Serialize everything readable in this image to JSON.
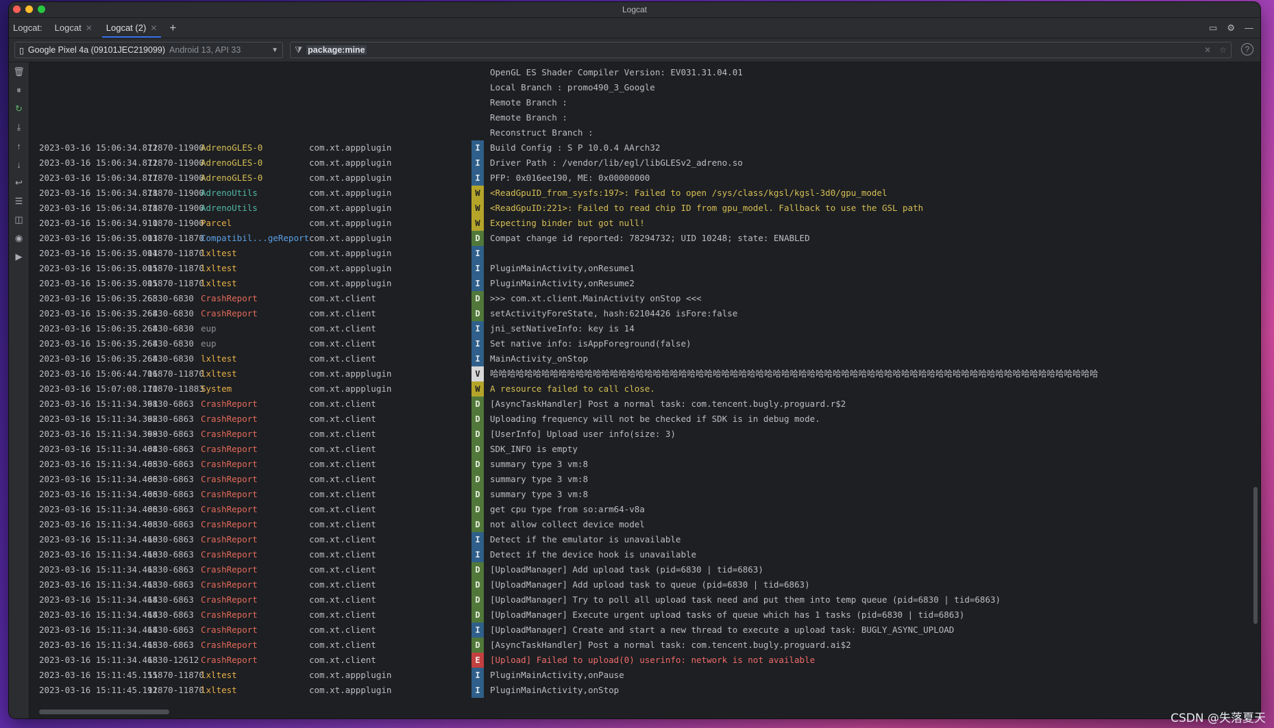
{
  "window": {
    "title": "Logcat"
  },
  "tabs": {
    "prefix": "Logcat:",
    "items": [
      {
        "label": "Logcat",
        "active": false
      },
      {
        "label": "Logcat (2)",
        "active": true
      }
    ]
  },
  "device": {
    "name": "Google Pixel 4a (09101JEC219099)",
    "detail": "Android 13, API 33"
  },
  "filter": {
    "value": "package:mine"
  },
  "header_rows": [
    "OpenGL ES Shader Compiler Version: EV031.31.04.01",
    "Local Branch                     : promo490_3_Google",
    "Remote Branch                    :",
    "Remote Branch                    :",
    "Reconstruct Branch               :"
  ],
  "log_rows": [
    {
      "time": "2023-03-16 15:06:34.872",
      "pid": "11870-11900",
      "tag": "AdrenoGLES-0",
      "tagc": "yellow",
      "pkg": "com.xt.appplugin",
      "lvl": "I",
      "msg": "Build Config                     : S P 10.0.4 AArch32"
    },
    {
      "time": "2023-03-16 15:06:34.872",
      "pid": "11870-11900",
      "tag": "AdrenoGLES-0",
      "tagc": "yellow",
      "pkg": "com.xt.appplugin",
      "lvl": "I",
      "msg": "Driver Path                      : /vendor/lib/egl/libGLESv2_adreno.so"
    },
    {
      "time": "2023-03-16 15:06:34.877",
      "pid": "11870-11900",
      "tag": "AdrenoGLES-0",
      "tagc": "yellow",
      "pkg": "com.xt.appplugin",
      "lvl": "I",
      "msg": "PFP: 0x016ee190, ME: 0x00000000"
    },
    {
      "time": "2023-03-16 15:06:34.878",
      "pid": "11870-11900",
      "tag": "AdrenoUtils",
      "tagc": "teal",
      "pkg": "com.xt.appplugin",
      "lvl": "W",
      "msg": "<ReadGpuID_from_sysfs:197>: Failed to open /sys/class/kgsl/kgsl-3d0/gpu_model"
    },
    {
      "time": "2023-03-16 15:06:34.878",
      "pid": "11870-11900",
      "tag": "AdrenoUtils",
      "tagc": "teal",
      "pkg": "com.xt.appplugin",
      "lvl": "W",
      "msg": "<ReadGpuID:221>: Failed to read chip ID from gpu_model. Fallback to use the GSL path"
    },
    {
      "time": "2023-03-16 15:06:34.910",
      "pid": "11870-11900",
      "tag": "Parcel",
      "tagc": "orange",
      "pkg": "com.xt.appplugin",
      "lvl": "W",
      "msg": "Expecting binder but got null!"
    },
    {
      "time": "2023-03-16 15:06:35.003",
      "pid": "11870-11870",
      "tag": "Compatibil...geReporter",
      "tagc": "blue",
      "pkg": "com.xt.appplugin",
      "lvl": "D",
      "msg": "Compat change id reported: 78294732; UID 10248; state: ENABLED"
    },
    {
      "time": "2023-03-16 15:06:35.004",
      "pid": "11870-11870",
      "tag": "lxltest",
      "tagc": "orange",
      "pkg": "com.xt.appplugin",
      "lvl": "I",
      "msg": ""
    },
    {
      "time": "2023-03-16 15:06:35.005",
      "pid": "11870-11870",
      "tag": "lxltest",
      "tagc": "orange",
      "pkg": "com.xt.appplugin",
      "lvl": "I",
      "msg": "PluginMainActivity,onResume1"
    },
    {
      "time": "2023-03-16 15:06:35.005",
      "pid": "11870-11870",
      "tag": "lxltest",
      "tagc": "orange",
      "pkg": "com.xt.appplugin",
      "lvl": "I",
      "msg": "PluginMainActivity,onResume2"
    },
    {
      "time": "2023-03-16 15:06:35.263",
      "pid": " 6830-6830",
      "tag": "CrashReport",
      "tagc": "red",
      "pkg": "com.xt.client",
      "lvl": "D",
      "msg": ">>> com.xt.client.MainActivity onStop <<<"
    },
    {
      "time": "2023-03-16 15:06:35.264",
      "pid": " 6830-6830",
      "tag": "CrashReport",
      "tagc": "red",
      "pkg": "com.xt.client",
      "lvl": "D",
      "msg": "setActivityForeState, hash:62104426 isFore:false"
    },
    {
      "time": "2023-03-16 15:06:35.264",
      "pid": " 6830-6830",
      "tag": "eup",
      "tagc": "gray",
      "pkg": "com.xt.client",
      "lvl": "I",
      "msg": "jni_setNativeInfo: key is 14"
    },
    {
      "time": "2023-03-16 15:06:35.264",
      "pid": " 6830-6830",
      "tag": "eup",
      "tagc": "gray",
      "pkg": "com.xt.client",
      "lvl": "I",
      "msg": "Set native info: isAppForeground(false)"
    },
    {
      "time": "2023-03-16 15:06:35.264",
      "pid": " 6830-6830",
      "tag": "lxltest",
      "tagc": "orange",
      "pkg": "com.xt.client",
      "lvl": "I",
      "msg": "MainActivity_onStop"
    },
    {
      "time": "2023-03-16 15:06:44.706",
      "pid": "11870-11870",
      "tag": "lxltest",
      "tagc": "orange",
      "pkg": "com.xt.appplugin",
      "lvl": "V",
      "msg": "哈哈哈哈哈哈哈哈哈哈哈哈哈哈哈哈哈哈哈哈哈哈哈哈哈哈哈哈哈哈哈哈哈哈哈哈哈哈哈哈哈哈哈哈哈哈哈哈哈哈哈哈哈哈哈哈哈哈哈哈哈哈哈哈哈哈哈哈哈哈哈"
    },
    {
      "time": "2023-03-16 15:07:08.170",
      "pid": "11870-11883",
      "tag": "System",
      "tagc": "orange",
      "pkg": "com.xt.appplugin",
      "lvl": "W",
      "msg": "A resource failed to call close."
    },
    {
      "time": "2023-03-16 15:11:34.391",
      "pid": " 6830-6863",
      "tag": "CrashReport",
      "tagc": "red",
      "pkg": "com.xt.client",
      "lvl": "D",
      "msg": "[AsyncTaskHandler] Post a normal task: com.tencent.bugly.proguard.r$2"
    },
    {
      "time": "2023-03-16 15:11:34.392",
      "pid": " 6830-6863",
      "tag": "CrashReport",
      "tagc": "red",
      "pkg": "com.xt.client",
      "lvl": "D",
      "msg": "Uploading frequency will not be checked if SDK is in debug mode."
    },
    {
      "time": "2023-03-16 15:11:34.399",
      "pid": " 6830-6863",
      "tag": "CrashReport",
      "tagc": "red",
      "pkg": "com.xt.client",
      "lvl": "D",
      "msg": "[UserInfo] Upload user info(size: 3)"
    },
    {
      "time": "2023-03-16 15:11:34.404",
      "pid": " 6830-6863",
      "tag": "CrashReport",
      "tagc": "red",
      "pkg": "com.xt.client",
      "lvl": "D",
      "msg": "SDK_INFO is empty"
    },
    {
      "time": "2023-03-16 15:11:34.405",
      "pid": " 6830-6863",
      "tag": "CrashReport",
      "tagc": "red",
      "pkg": "com.xt.client",
      "lvl": "D",
      "msg": "summary type 3 vm:8"
    },
    {
      "time": "2023-03-16 15:11:34.406",
      "pid": " 6830-6863",
      "tag": "CrashReport",
      "tagc": "red",
      "pkg": "com.xt.client",
      "lvl": "D",
      "msg": "summary type 3 vm:8"
    },
    {
      "time": "2023-03-16 15:11:34.406",
      "pid": " 6830-6863",
      "tag": "CrashReport",
      "tagc": "red",
      "pkg": "com.xt.client",
      "lvl": "D",
      "msg": "summary type 3 vm:8"
    },
    {
      "time": "2023-03-16 15:11:34.406",
      "pid": " 6830-6863",
      "tag": "CrashReport",
      "tagc": "red",
      "pkg": "com.xt.client",
      "lvl": "D",
      "msg": "get cpu type from so:arm64-v8a"
    },
    {
      "time": "2023-03-16 15:11:34.408",
      "pid": " 6830-6863",
      "tag": "CrashReport",
      "tagc": "red",
      "pkg": "com.xt.client",
      "lvl": "D",
      "msg": "not allow collect device model"
    },
    {
      "time": "2023-03-16 15:11:34.410",
      "pid": " 6830-6863",
      "tag": "CrashReport",
      "tagc": "red",
      "pkg": "com.xt.client",
      "lvl": "I",
      "msg": "Detect if the emulator is unavailable"
    },
    {
      "time": "2023-03-16 15:11:34.410",
      "pid": " 6830-6863",
      "tag": "CrashReport",
      "tagc": "red",
      "pkg": "com.xt.client",
      "lvl": "I",
      "msg": "Detect if the device hook is unavailable"
    },
    {
      "time": "2023-03-16 15:11:34.413",
      "pid": " 6830-6863",
      "tag": "CrashReport",
      "tagc": "red",
      "pkg": "com.xt.client",
      "lvl": "D",
      "msg": "[UploadManager] Add upload task (pid=6830 | tid=6863)"
    },
    {
      "time": "2023-03-16 15:11:34.413",
      "pid": " 6830-6863",
      "tag": "CrashReport",
      "tagc": "red",
      "pkg": "com.xt.client",
      "lvl": "D",
      "msg": "[UploadManager] Add upload task to queue (pid=6830 | tid=6863)"
    },
    {
      "time": "2023-03-16 15:11:34.414",
      "pid": " 6830-6863",
      "tag": "CrashReport",
      "tagc": "red",
      "pkg": "com.xt.client",
      "lvl": "D",
      "msg": "[UploadManager] Try to poll all upload task need and put them into temp queue (pid=6830 | tid=6863)"
    },
    {
      "time": "2023-03-16 15:11:34.414",
      "pid": " 6830-6863",
      "tag": "CrashReport",
      "tagc": "red",
      "pkg": "com.xt.client",
      "lvl": "D",
      "msg": "[UploadManager] Execute urgent upload tasks of queue which has 1 tasks (pid=6830 | tid=6863)"
    },
    {
      "time": "2023-03-16 15:11:34.414",
      "pid": " 6830-6863",
      "tag": "CrashReport",
      "tagc": "red",
      "pkg": "com.xt.client",
      "lvl": "I",
      "msg": "[UploadManager] Create and start a new thread to execute a upload task: BUGLY_ASYNC_UPLOAD"
    },
    {
      "time": "2023-03-16 15:11:34.415",
      "pid": " 6830-6863",
      "tag": "CrashReport",
      "tagc": "red",
      "pkg": "com.xt.client",
      "lvl": "D",
      "msg": "[AsyncTaskHandler] Post a normal task: com.tencent.bugly.proguard.ai$2"
    },
    {
      "time": "2023-03-16 15:11:34.418",
      "pid": " 6830-12612",
      "tag": "CrashReport",
      "tagc": "red",
      "pkg": "com.xt.client",
      "lvl": "E",
      "msg": "[Upload] Failed to upload(0) userinfo: network is not available"
    },
    {
      "time": "2023-03-16 15:11:45.155",
      "pid": "11870-11870",
      "tag": "lxltest",
      "tagc": "orange",
      "pkg": "com.xt.appplugin",
      "lvl": "I",
      "msg": "PluginMainActivity,onPause"
    },
    {
      "time": "2023-03-16 15:11:45.192",
      "pid": "11870-11870",
      "tag": "lxltest",
      "tagc": "orange",
      "pkg": "com.xt.appplugin",
      "lvl": "I",
      "msg": "PluginMainActivity,onStop"
    }
  ],
  "sidebar_icons": [
    "trash-icon",
    "pause-icon",
    "restart-icon",
    "scroll-to-end-icon",
    "up-arrow-icon",
    "down-arrow-icon",
    "soft-wrap-icon",
    "format-icon",
    "split-icon",
    "camera-icon",
    "video-icon"
  ],
  "watermark": "CSDN @失落夏天"
}
